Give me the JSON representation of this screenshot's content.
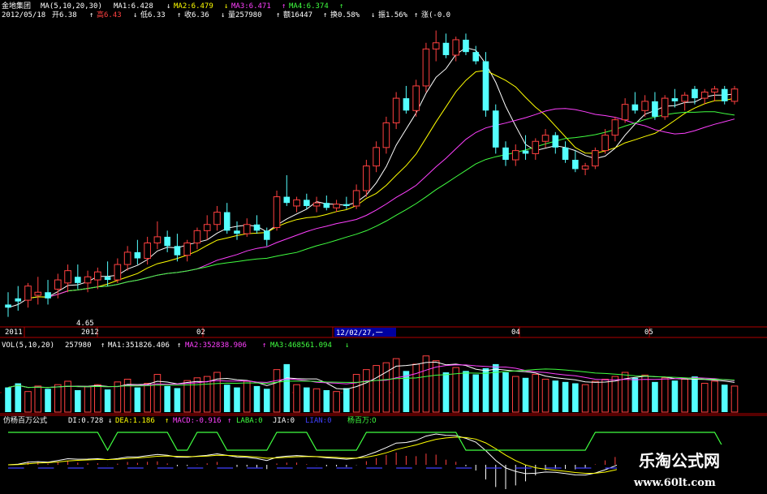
{
  "header": {
    "stock_name": "金地集团",
    "ma_label": "MA(5,10,20,30)",
    "ma1": "MA1:6.428",
    "ma2": "MA2:6.479",
    "ma3": "MA3:6.471",
    "ma4": "MA4:6.374",
    "date": "2012/05/18",
    "open": "开6.38",
    "high": "高6.43",
    "low": "低6.33",
    "close": "收6.36",
    "volume": "量257980",
    "amount": "额16447",
    "turnover": "换0.58%",
    "amplitude": "振1.56%",
    "change": "涨(-0.0"
  },
  "price_panel": {
    "low_marker": "4.65",
    "time_labels": [
      "2011",
      "2012",
      "02",
      "04",
      "05"
    ],
    "cursor_label": "12/02/27,一"
  },
  "vol_header": {
    "label": "VOL(5,10,20)",
    "value": "257980",
    "ma1": "MA1:351826.406",
    "ma2": "MA2:352838.906",
    "ma3": "MA3:468561.094"
  },
  "ind_header": {
    "name": "仿杨百万公式",
    "di": "DI:0.728",
    "dea": "DEA:1.186",
    "macd": "MACD:-0.916",
    "laba": "LABA:0",
    "jia": "JIA:0",
    "lian": "LIAN:0",
    "ybw": "杨百万:0"
  },
  "watermark": {
    "title": "乐淘公式网",
    "url": "www.60lt.com"
  },
  "colors": {
    "up": "#ff4040",
    "down": "#54ffff",
    "ma_white": "#ffffff",
    "ma_yellow": "#ffff00",
    "ma_magenta": "#ff40ff",
    "ma_green": "#40ff40",
    "grid": "#8c0000",
    "frame": "#b00000",
    "cursor_bg": "#0000a0",
    "lian": "#4040ff"
  },
  "chart_data": {
    "type": "candlestick",
    "series_candles": [
      {
        "o": 4.85,
        "h": 5.05,
        "l": 4.65,
        "c": 4.8
      },
      {
        "o": 4.95,
        "h": 5.15,
        "l": 4.75,
        "c": 4.9
      },
      {
        "o": 4.92,
        "h": 5.2,
        "l": 4.8,
        "c": 5.15
      },
      {
        "o": 5.0,
        "h": 5.3,
        "l": 4.85,
        "c": 5.05
      },
      {
        "o": 5.05,
        "h": 5.25,
        "l": 4.85,
        "c": 4.95
      },
      {
        "o": 5.1,
        "h": 5.35,
        "l": 4.95,
        "c": 5.25
      },
      {
        "o": 5.2,
        "h": 5.5,
        "l": 5.05,
        "c": 5.4
      },
      {
        "o": 5.3,
        "h": 5.5,
        "l": 5.1,
        "c": 5.2
      },
      {
        "o": 5.2,
        "h": 5.4,
        "l": 5.05,
        "c": 5.3
      },
      {
        "o": 5.25,
        "h": 5.45,
        "l": 5.1,
        "c": 5.38
      },
      {
        "o": 5.3,
        "h": 5.55,
        "l": 5.15,
        "c": 5.25
      },
      {
        "o": 5.25,
        "h": 5.6,
        "l": 5.2,
        "c": 5.5
      },
      {
        "o": 5.5,
        "h": 5.8,
        "l": 5.4,
        "c": 5.7
      },
      {
        "o": 5.7,
        "h": 5.9,
        "l": 5.5,
        "c": 5.6
      },
      {
        "o": 5.6,
        "h": 5.95,
        "l": 5.5,
        "c": 5.85
      },
      {
        "o": 5.85,
        "h": 6.2,
        "l": 5.75,
        "c": 5.95
      },
      {
        "o": 5.95,
        "h": 6.05,
        "l": 5.7,
        "c": 5.8
      },
      {
        "o": 5.8,
        "h": 6.0,
        "l": 5.55,
        "c": 5.65
      },
      {
        "o": 5.65,
        "h": 5.9,
        "l": 5.55,
        "c": 5.85
      },
      {
        "o": 5.85,
        "h": 6.1,
        "l": 5.75,
        "c": 6.05
      },
      {
        "o": 6.05,
        "h": 6.3,
        "l": 5.9,
        "c": 6.15
      },
      {
        "o": 6.15,
        "h": 6.45,
        "l": 6.05,
        "c": 6.35
      },
      {
        "o": 6.35,
        "h": 6.5,
        "l": 6.0,
        "c": 6.05
      },
      {
        "o": 6.05,
        "h": 6.2,
        "l": 5.9,
        "c": 6.0
      },
      {
        "o": 6.0,
        "h": 6.25,
        "l": 5.95,
        "c": 6.15
      },
      {
        "o": 6.15,
        "h": 6.3,
        "l": 6.0,
        "c": 6.05
      },
      {
        "o": 6.05,
        "h": 6.1,
        "l": 5.8,
        "c": 5.9
      },
      {
        "o": 6.1,
        "h": 6.7,
        "l": 6.05,
        "c": 6.6
      },
      {
        "o": 6.6,
        "h": 6.95,
        "l": 6.45,
        "c": 6.5
      },
      {
        "o": 6.45,
        "h": 6.6,
        "l": 6.35,
        "c": 6.55
      },
      {
        "o": 6.55,
        "h": 6.65,
        "l": 6.4,
        "c": 6.45
      },
      {
        "o": 6.45,
        "h": 6.6,
        "l": 6.35,
        "c": 6.5
      },
      {
        "o": 6.5,
        "h": 6.62,
        "l": 6.38,
        "c": 6.42
      },
      {
        "o": 6.42,
        "h": 6.55,
        "l": 6.35,
        "c": 6.48
      },
      {
        "o": 6.48,
        "h": 6.6,
        "l": 6.4,
        "c": 6.45
      },
      {
        "o": 6.45,
        "h": 6.8,
        "l": 6.4,
        "c": 6.7
      },
      {
        "o": 6.7,
        "h": 7.2,
        "l": 6.6,
        "c": 7.1
      },
      {
        "o": 7.1,
        "h": 7.5,
        "l": 7.0,
        "c": 7.4
      },
      {
        "o": 7.4,
        "h": 7.9,
        "l": 7.3,
        "c": 7.8
      },
      {
        "o": 7.8,
        "h": 8.3,
        "l": 7.7,
        "c": 8.2
      },
      {
        "o": 8.2,
        "h": 8.4,
        "l": 7.95,
        "c": 8.0
      },
      {
        "o": 8.0,
        "h": 8.5,
        "l": 7.9,
        "c": 8.4
      },
      {
        "o": 8.4,
        "h": 9.1,
        "l": 8.3,
        "c": 9.0
      },
      {
        "o": 9.0,
        "h": 9.3,
        "l": 8.8,
        "c": 9.1
      },
      {
        "o": 9.1,
        "h": 9.25,
        "l": 8.85,
        "c": 8.9
      },
      {
        "o": 8.9,
        "h": 9.2,
        "l": 8.8,
        "c": 9.15
      },
      {
        "o": 9.15,
        "h": 9.25,
        "l": 8.9,
        "c": 8.95
      },
      {
        "o": 8.95,
        "h": 9.05,
        "l": 8.75,
        "c": 8.8
      },
      {
        "o": 8.8,
        "h": 8.95,
        "l": 7.9,
        "c": 8.0
      },
      {
        "o": 8.0,
        "h": 8.1,
        "l": 7.3,
        "c": 7.4
      },
      {
        "o": 7.4,
        "h": 7.5,
        "l": 7.1,
        "c": 7.2
      },
      {
        "o": 7.2,
        "h": 7.45,
        "l": 7.1,
        "c": 7.35
      },
      {
        "o": 7.35,
        "h": 7.6,
        "l": 7.2,
        "c": 7.3
      },
      {
        "o": 7.3,
        "h": 7.55,
        "l": 7.2,
        "c": 7.5
      },
      {
        "o": 7.5,
        "h": 7.7,
        "l": 7.4,
        "c": 7.6
      },
      {
        "o": 7.6,
        "h": 7.65,
        "l": 7.3,
        "c": 7.4
      },
      {
        "o": 7.4,
        "h": 7.5,
        "l": 7.15,
        "c": 7.2
      },
      {
        "o": 7.2,
        "h": 7.35,
        "l": 7.0,
        "c": 7.05
      },
      {
        "o": 7.05,
        "h": 7.15,
        "l": 6.95,
        "c": 7.1
      },
      {
        "o": 7.1,
        "h": 7.4,
        "l": 7.05,
        "c": 7.35
      },
      {
        "o": 7.35,
        "h": 7.7,
        "l": 7.3,
        "c": 7.6
      },
      {
        "o": 7.6,
        "h": 7.9,
        "l": 7.5,
        "c": 7.85
      },
      {
        "o": 7.85,
        "h": 8.2,
        "l": 7.8,
        "c": 8.1
      },
      {
        "o": 8.1,
        "h": 8.3,
        "l": 7.95,
        "c": 8.0
      },
      {
        "o": 8.0,
        "h": 8.25,
        "l": 7.9,
        "c": 8.15
      },
      {
        "o": 8.15,
        "h": 8.3,
        "l": 7.85,
        "c": 7.9
      },
      {
        "o": 7.9,
        "h": 8.25,
        "l": 7.85,
        "c": 8.2
      },
      {
        "o": 8.2,
        "h": 8.35,
        "l": 8.05,
        "c": 8.15
      },
      {
        "o": 8.15,
        "h": 8.3,
        "l": 8.0,
        "c": 8.25
      },
      {
        "o": 8.35,
        "h": 8.4,
        "l": 8.1,
        "c": 8.2
      },
      {
        "o": 8.2,
        "h": 8.35,
        "l": 8.1,
        "c": 8.3
      },
      {
        "o": 8.3,
        "h": 8.4,
        "l": 8.15,
        "c": 8.35
      },
      {
        "o": 8.35,
        "h": 8.4,
        "l": 8.1,
        "c": 8.15
      },
      {
        "o": 8.15,
        "h": 8.4,
        "l": 8.1,
        "c": 8.35
      }
    ],
    "volume_values": [
      36,
      42,
      30,
      38,
      34,
      40,
      45,
      32,
      37,
      40,
      33,
      44,
      48,
      36,
      42,
      55,
      38,
      35,
      46,
      50,
      52,
      58,
      40,
      36,
      45,
      38,
      34,
      62,
      70,
      40,
      36,
      34,
      32,
      30,
      35,
      55,
      62,
      68,
      72,
      78,
      60,
      70,
      82,
      75,
      58,
      65,
      60,
      55,
      64,
      70,
      58,
      52,
      50,
      55,
      48,
      46,
      44,
      42,
      40,
      45,
      48,
      52,
      58,
      50,
      54,
      44,
      50,
      46,
      48,
      52,
      42,
      45,
      40,
      38
    ],
    "ylim": [
      4.5,
      9.4
    ],
    "volume_ylim": [
      0,
      90
    ]
  }
}
